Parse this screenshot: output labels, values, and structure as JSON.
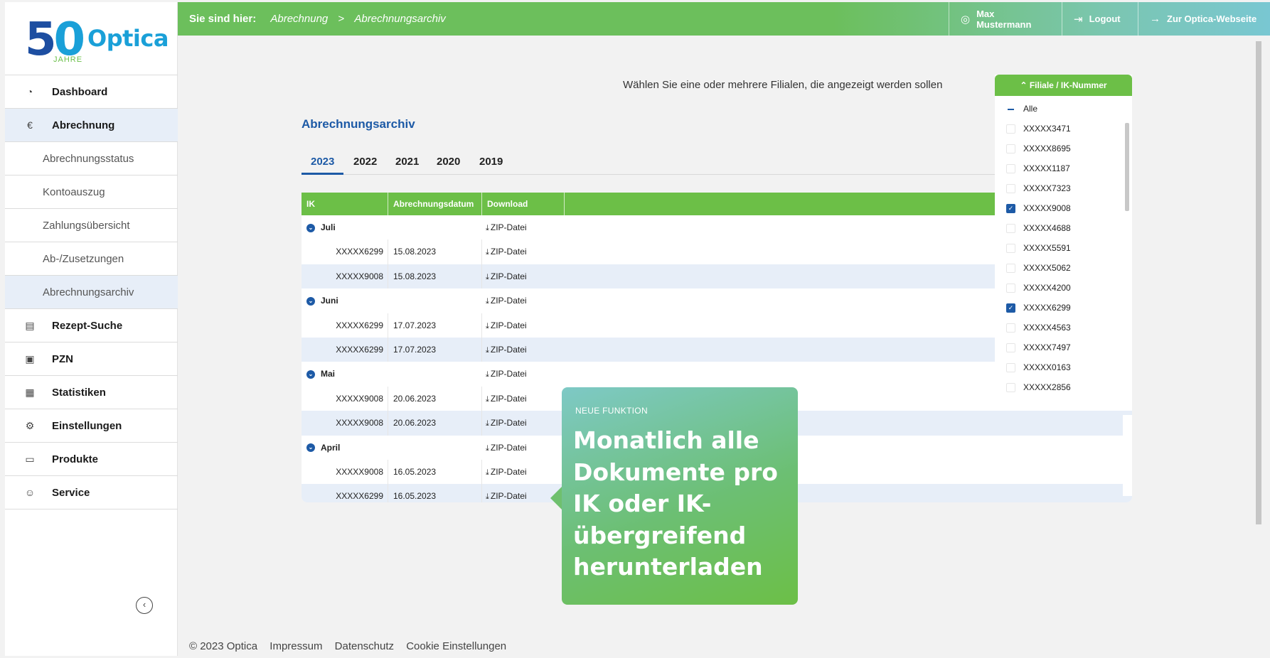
{
  "logo": {
    "number_first": "5",
    "number_second": "0",
    "sub": "JAHRE",
    "brand": "Optica"
  },
  "sidebar": {
    "items": [
      {
        "label": "Dashboard",
        "icon": "gauge-icon"
      },
      {
        "label": "Abrechnung",
        "icon": "euro-icon"
      },
      {
        "label": "Abrechnungsstatus"
      },
      {
        "label": "Kontoauszug"
      },
      {
        "label": "Zahlungsübersicht"
      },
      {
        "label": "Ab-/Zusetzungen"
      },
      {
        "label": "Abrechnungsarchiv"
      },
      {
        "label": "Rezept-Suche",
        "icon": "prescription-icon"
      },
      {
        "label": "PZN",
        "icon": "pzn-icon"
      },
      {
        "label": "Statistiken",
        "icon": "chart-icon"
      },
      {
        "label": "Einstellungen",
        "icon": "gears-icon"
      },
      {
        "label": "Produkte",
        "icon": "devices-icon"
      },
      {
        "label": "Service",
        "icon": "people-icon"
      }
    ]
  },
  "topbar": {
    "breadcrumb_label": "Sie sind hier:",
    "crumb1": "Abrechnung",
    "separator": ">",
    "crumb2": "Abrechnungsarchiv",
    "user": "Max Mustermann",
    "logout": "Logout",
    "website": "Zur Optica-Webseite"
  },
  "main": {
    "hint": "Wählen Sie eine oder mehrere Filialen, die angezeigt werden sollen",
    "title": "Abrechnungsarchiv",
    "tabs": [
      "2023",
      "2022",
      "2021",
      "2020",
      "2019"
    ]
  },
  "table": {
    "headers": [
      "IK",
      "Abrechnungsdatum",
      "Download"
    ],
    "download_label": "ZIP-Datei",
    "months": [
      {
        "name": "Juli",
        "rows": [
          {
            "ik": "XXXXX6299",
            "date": "15.08.2023"
          },
          {
            "ik": "XXXXX9008",
            "date": "15.08.2023"
          }
        ]
      },
      {
        "name": "Juni",
        "rows": [
          {
            "ik": "XXXXX6299",
            "date": "17.07.2023"
          },
          {
            "ik": "XXXXX6299",
            "date": "17.07.2023"
          }
        ]
      },
      {
        "name": "Mai",
        "rows": [
          {
            "ik": "XXXXX9008",
            "date": "20.06.2023"
          },
          {
            "ik": "XXXXX9008",
            "date": "20.06.2023"
          }
        ]
      },
      {
        "name": "April",
        "rows": [
          {
            "ik": "XXXXX9008",
            "date": "16.05.2023"
          },
          {
            "ik": "XXXXX6299",
            "date": "16.05.2023"
          }
        ]
      }
    ]
  },
  "dropdown": {
    "header": "Filiale / IK-Nummer",
    "items": [
      {
        "label": "Alle",
        "state": "indeterminate"
      },
      {
        "label": "XXXXX3471",
        "state": "unchecked"
      },
      {
        "label": "XXXXX8695",
        "state": "unchecked"
      },
      {
        "label": "XXXXX1187",
        "state": "unchecked"
      },
      {
        "label": "XXXXX7323",
        "state": "unchecked"
      },
      {
        "label": "XXXXX9008",
        "state": "checked"
      },
      {
        "label": "XXXXX4688",
        "state": "unchecked"
      },
      {
        "label": "XXXXX5591",
        "state": "unchecked"
      },
      {
        "label": "XXXXX5062",
        "state": "unchecked"
      },
      {
        "label": "XXXXX4200",
        "state": "unchecked"
      },
      {
        "label": "XXXXX6299",
        "state": "checked"
      },
      {
        "label": "XXXXX4563",
        "state": "unchecked"
      },
      {
        "label": "XXXXX7497",
        "state": "unchecked"
      },
      {
        "label": "XXXXX0163",
        "state": "unchecked"
      },
      {
        "label": "XXXXX2856",
        "state": "unchecked"
      }
    ]
  },
  "promo": {
    "kicker": "NEUE FUNKTION",
    "headline_lines": [
      "Monatlich alle",
      "Dokumente pro",
      "IK oder IK-",
      "übergreifend",
      "herunterladen"
    ]
  },
  "footer": {
    "copyright": "© 2023 Optica",
    "links": [
      "Impressum",
      "Datenschutz",
      "Cookie Einstellungen"
    ]
  },
  "colors": {
    "accent_green": "#6cbf47",
    "brand_blue": "#1d5aa6",
    "active_bg": "#e7eef8"
  }
}
